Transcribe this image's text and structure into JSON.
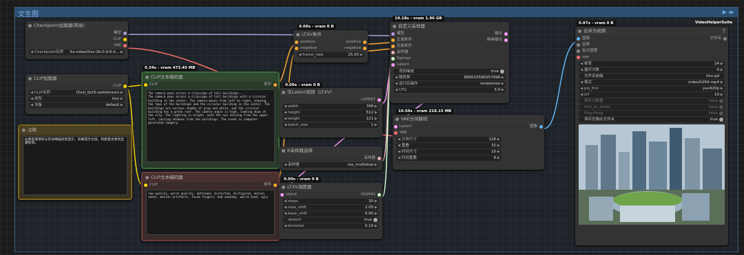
{
  "group": {
    "title": "文生图"
  },
  "nodes": {
    "checkpoint": {
      "title": "Checkpoint加载器(简易)",
      "out_model": "模型",
      "out_clip": "CLIP",
      "out_vae": "VAE",
      "w_label": "Checkpoint名称",
      "w_value": "ltx-video/ltxv-2b-0.9.6-d..."
    },
    "clip_loader": {
      "title": "CLIP加载器",
      "out_clip": "CLIP",
      "w1_label": "CLIP名称",
      "w1_value": "t5xxl_fp16.safetensors",
      "w2_label": "类型",
      "w2_value": "ltxv",
      "w3_label": "设备",
      "w3_value": "default"
    },
    "note": {
      "title": "注释",
      "text": "此模型需要较长的详细描述性提示，如果提示太短，则质量会受到显著影响。"
    },
    "clip_text_pos": {
      "badge": "0.34s - vram 473.45 MB",
      "title": "CLIP文本编码器",
      "in_clip": "CLIP",
      "out": "条件",
      "text": "The camera pans across a cityscape of tall buildings...\nThe camera pans across a cityscape of tall buildings with a circular building in the center. The camera moves from left to right, showing the tops of the buildings and the circular building in the center. The buildings are various shades of gray and white, and the circular building has a green roof. The camera angle is high, looking down at the city. The lighting is bright, with the sun shining from the upper left, casting shadows from the buildings. The scene is computer-generated imagery."
    },
    "clip_text_neg": {
      "title": "CLIP文本编码器",
      "in_clip": "CLIP",
      "out": "条件",
      "text": "low quality, worst quality, deformed, distorted, disfigured, motion smear, motion artifacts, fused fingers, bad anatomy, weird hand, ugly"
    },
    "ltxv_cond": {
      "badge": "0.00s - vram 0 B",
      "title": "LTXV条件",
      "in_pos": "positive",
      "in_neg": "negative",
      "out_pos": "positive",
      "out_neg": "negative",
      "w_label": "frame_rate",
      "w_value": "25.00"
    },
    "latent": {
      "badge": "0.00s - vram 0 B",
      "title": "空Latent视频（LTXV）",
      "out": "LATENT",
      "w": [
        {
          "label": "width",
          "value": "768"
        },
        {
          "label": "height",
          "value": "512"
        },
        {
          "label": "length",
          "value": "121"
        },
        {
          "label": "batch_size",
          "value": "1"
        }
      ]
    },
    "ksampler_select": {
      "title": "K采样器选择",
      "out": "采样器",
      "w_label": "采样器",
      "w_value": "res_multistep"
    },
    "scheduler": {
      "badge": "0.00s - vram 0 B",
      "title": "LTXV调度器",
      "in": "latent",
      "out": "SIGMAS",
      "w": [
        {
          "label": "steps",
          "value": "30"
        },
        {
          "label": "max_shift",
          "value": "2.05"
        },
        {
          "label": "base_shift",
          "value": "0.95"
        },
        {
          "label": "stretch",
          "value": "true"
        },
        {
          "label": "terminal",
          "value": "0.10"
        }
      ]
    },
    "custom_sampler": {
      "badge": "19.18s - vram 1.96 GB",
      "title": "自定义采样器",
      "ins": [
        "模型",
        "正面条件",
        "负面条件",
        "采样器",
        "Sigmas",
        "Latent"
      ],
      "outs": [
        "输出",
        "降噪输出"
      ],
      "w": [
        {
          "label": "添加噪波",
          "value": "true"
        },
        {
          "label": "随机种",
          "value": "680633596357498"
        },
        {
          "label": "运行后操作",
          "value": "randomize"
        },
        {
          "label": "CFG",
          "value": "3.0"
        }
      ]
    },
    "vae_decode": {
      "badge": "10.50s - vram 218.15 MB",
      "title": "VAE分块解码",
      "ins": [
        "Latent",
        "VAE"
      ],
      "out": "图像",
      "w": [
        {
          "label": "分块尺寸",
          "value": "128"
        },
        {
          "label": "重叠",
          "value": "32"
        },
        {
          "label": "时间尺寸",
          "value": "16"
        },
        {
          "label": "时间重叠",
          "value": "8"
        }
      ]
    },
    "combine": {
      "badge": "0.97s - vram 0 B",
      "suite": "VideoHelperSuite",
      "title": "合并为视频",
      "help": "?",
      "ins": [
        "图像",
        "音频",
        "批次管理",
        "vae"
      ],
      "out": "文件名",
      "w": [
        {
          "label": "帧率",
          "value": "24"
        },
        {
          "label": "循环次数",
          "value": "0"
        },
        {
          "label": "文件名前缀",
          "value": "ltxv-gd"
        },
        {
          "label": "格式",
          "value": "video/h264-mp4"
        },
        {
          "label": "pix_fmt",
          "value": "yuv420p"
        },
        {
          "label": "crf",
          "value": "19"
        },
        {
          "label": "保存元数据",
          "value": "false"
        },
        {
          "label": "trim_to_audio",
          "value": "false"
        },
        {
          "label": "Ping-Pong",
          "value": "false"
        },
        {
          "label": "保存至输出文件夹",
          "value": "true"
        }
      ]
    }
  },
  "colors": {
    "clip": "#ffd500",
    "model": "#b39ddb",
    "vae": "#ff6e6e",
    "cond": "#ffa931",
    "latent": "#ff9cf9",
    "sigmas": "#cdffcd",
    "sampler": "#ecb4b4",
    "image": "#64b5f6"
  }
}
